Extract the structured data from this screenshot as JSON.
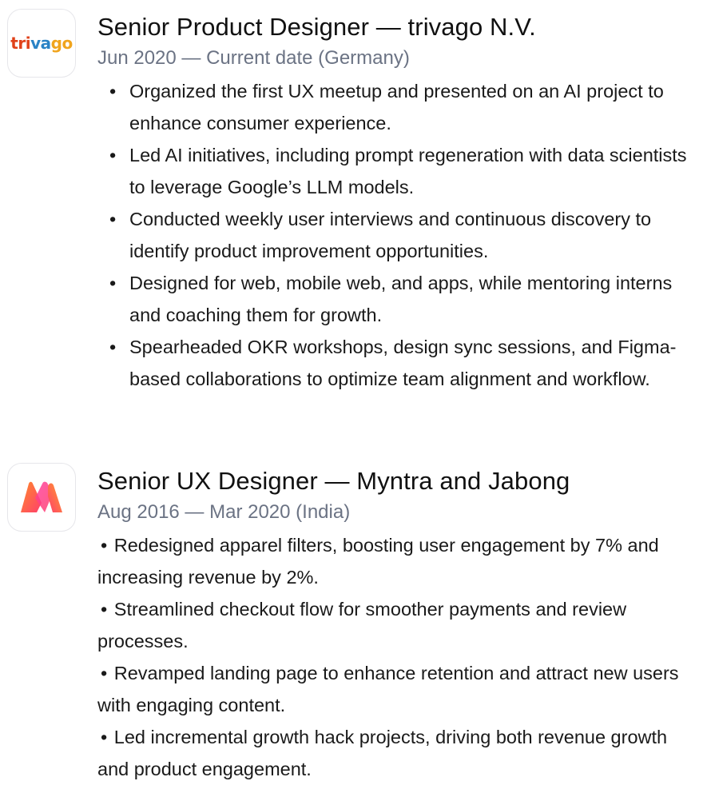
{
  "jobs": [
    {
      "logo": {
        "icon": "trivago-logo",
        "text": "trivago"
      },
      "title": "Senior Product Designer — trivago N.V.",
      "meta": "Jun 2020 — Current date (Germany)",
      "bullets": [
        "Organized the first UX meetup and presented on an AI project to enhance consumer experience.",
        "Led AI initiatives, including prompt regeneration with data scientists to leverage Google’s LLM models.",
        "Conducted weekly user interviews and continuous discovery to identify product improvement opportunities.",
        "Designed for web, mobile web, and apps, while mentoring interns and coaching them for growth.",
        "Spearheaded OKR workshops, design sync sessions, and Figma-based collaborations to optimize team alignment and workflow."
      ]
    },
    {
      "logo": {
        "icon": "myntra-logo"
      },
      "title": "Senior UX Designer — Myntra and Jabong",
      "meta": "Aug 2016 — Mar 2020 (India)",
      "bullets": [
        "Redesigned apparel filters, boosting user engagement by 7% and increasing revenue by 2%.",
        "Streamlined checkout flow for smoother payments and review processes.",
        "Revamped landing page to enhance retention and attract new users with engaging content.",
        "Led incremental growth hack projects, driving both revenue growth and product engagement."
      ]
    }
  ],
  "colors": {
    "title": "#111111",
    "meta": "#6b7384",
    "body": "#1a1a1a",
    "logo_border": "#e6e6ea",
    "trivago_red": "#e0421a",
    "trivago_blue": "#2a83c6",
    "trivago_orange": "#f0a41d",
    "myntra_pink": "#ff3f6c",
    "myntra_orange": "#ff8a2b"
  }
}
